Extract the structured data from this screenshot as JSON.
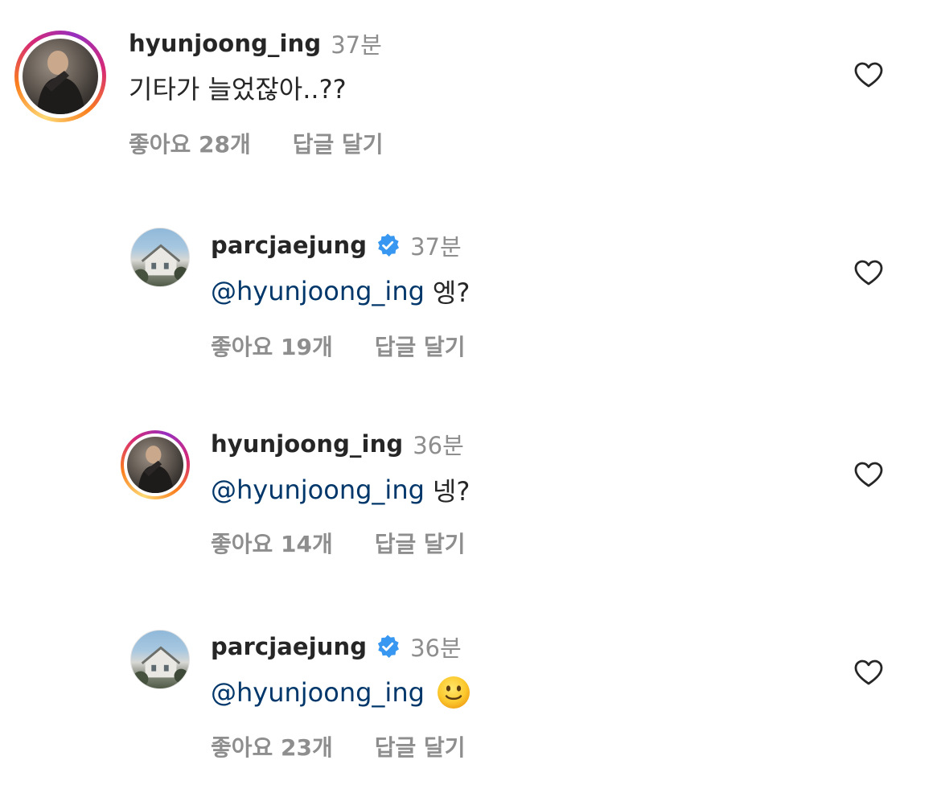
{
  "comments": [
    {
      "username": "hyunjoong_ing",
      "time": "37분",
      "mention": "",
      "text": "기타가 늘었잖아..??",
      "likes": "좋아요 28개",
      "reply": "답글 달기",
      "verified": false,
      "avatar_icon": "person-photo",
      "story_ring": true
    },
    {
      "username": "parcjaejung",
      "time": "37분",
      "mention": "@hyunjoong_ing",
      "text": "엥?",
      "likes": "좋아요 19개",
      "reply": "답글 달기",
      "verified": true,
      "avatar_icon": "house-photo",
      "story_ring": false
    },
    {
      "username": "hyunjoong_ing",
      "time": "36분",
      "mention": "@hyunjoong_ing",
      "text": "넹?",
      "likes": "좋아요 14개",
      "reply": "답글 달기",
      "verified": false,
      "avatar_icon": "person-photo",
      "story_ring": true
    },
    {
      "username": "parcjaejung",
      "time": "36분",
      "mention": "@hyunjoong_ing",
      "text": "",
      "emoji": "slightly-smiling-face",
      "likes": "좋아요 23개",
      "reply": "답글 달기",
      "verified": true,
      "avatar_icon": "house-photo",
      "story_ring": false
    }
  ],
  "colors": {
    "username": "#262626",
    "mention": "#00376b",
    "secondary": "#8e8e8e",
    "verified": "#3897f0"
  }
}
